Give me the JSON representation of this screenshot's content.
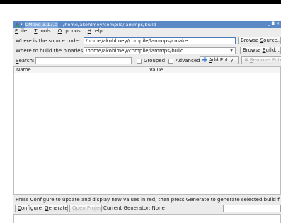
{
  "window": {
    "title_app": "CMake 3.17.0",
    "title_sep": " - ",
    "title_path": "/home/akohlmey/compile/lammps/build",
    "title_buttons": "_ ◘ ✕"
  },
  "menu": {
    "items": [
      {
        "prefix": "",
        "accel": "F",
        "rest": "ile"
      },
      {
        "prefix": "",
        "accel": "T",
        "rest": "ools"
      },
      {
        "prefix": "",
        "accel": "O",
        "rest": "ptions"
      },
      {
        "prefix": "",
        "accel": "H",
        "rest": "elp"
      }
    ]
  },
  "source": {
    "label": "Where is the source code:",
    "value": "/home/akohlmey/compile/lammps/cmake",
    "browse_pre": "Browse ",
    "browse_accel": "S",
    "browse_post": "ource..."
  },
  "build": {
    "label": "Where to build the binaries:",
    "value": "/home/akohlmey/compile/lammps/build",
    "browse_pre": "Browse ",
    "browse_accel": "B",
    "browse_post": "uild..."
  },
  "search": {
    "label_accel": "S",
    "label_rest": "earch:",
    "value": "",
    "grouped_label": "Grouped",
    "advanced_label": "Advanced",
    "add_entry_pre": "",
    "add_entry_accel": "A",
    "add_entry_post": "dd Entry",
    "remove_entry_pre": "",
    "remove_entry_accel": "R",
    "remove_entry_post": "emove Entry"
  },
  "table": {
    "columns": [
      "Name",
      "Value"
    ],
    "rows": []
  },
  "status_text": "Press Configure to update and display new values in red, then press Generate to generate selected build files.",
  "actions": {
    "configure_accel": "C",
    "configure_rest": "onfigure",
    "generate_accel": "G",
    "generate_rest": "enerate",
    "open_project": "Open Project",
    "current_generator": "Current Generator: None"
  },
  "icons": {
    "app": "cmake-triangle-icon",
    "add": "plus-icon",
    "remove": "x-icon"
  },
  "colors": {
    "titlebar": "#5a89c6",
    "add_icon": "#3a78c8",
    "remove_icon": "#b0b0b0"
  }
}
